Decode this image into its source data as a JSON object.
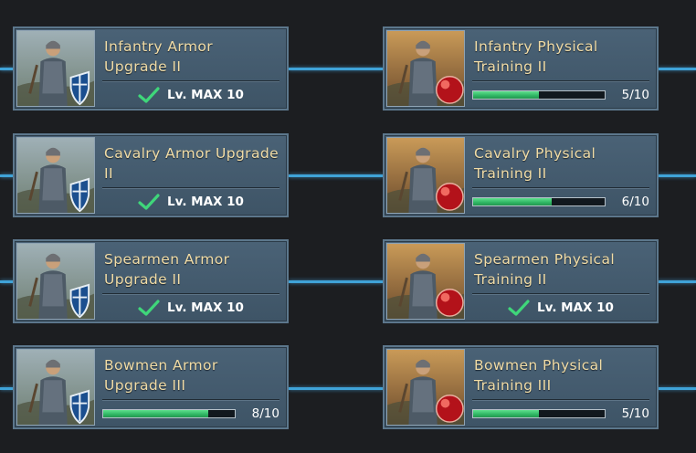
{
  "cards": [
    {
      "id": "infantry-armor",
      "title": "Infantry Armor\nUpgrade II",
      "type": "armor",
      "status": "max",
      "max_label": "Lv. MAX 10"
    },
    {
      "id": "infantry-physical",
      "title": "Infantry Physical\nTraining II",
      "type": "physical",
      "status": "progress",
      "progress_text": "5/10",
      "progress_fraction": 0.5
    },
    {
      "id": "cavalry-armor",
      "title": "Cavalry Armor Upgrade\n II",
      "type": "armor",
      "status": "max",
      "max_label": "Lv. MAX 10"
    },
    {
      "id": "cavalry-physical",
      "title": "Cavalry Physical\nTraining II",
      "type": "physical",
      "status": "progress",
      "progress_text": "6/10",
      "progress_fraction": 0.6
    },
    {
      "id": "spearmen-armor",
      "title": "Spearmen Armor\nUpgrade II",
      "type": "armor",
      "status": "max",
      "max_label": "Lv. MAX 10"
    },
    {
      "id": "spearmen-physical",
      "title": "Spearmen Physical\nTraining II",
      "type": "physical",
      "status": "max",
      "max_label": "Lv. MAX 10"
    },
    {
      "id": "bowmen-armor",
      "title": "Bowmen Armor\nUpgrade III",
      "type": "armor",
      "status": "progress",
      "progress_text": "8/10",
      "progress_fraction": 0.8
    },
    {
      "id": "bowmen-physical",
      "title": "Bowmen Physical\nTraining III",
      "type": "physical",
      "status": "progress",
      "progress_text": "5/10",
      "progress_fraction": 0.5
    }
  ],
  "colors": {
    "title_text": "#f1dca6",
    "connector": "#3fa3d8",
    "progress_fill": "#2fb563",
    "check": "#3fd67a"
  },
  "icons": {
    "max_status": "check-icon",
    "armor_badge": "shield-icon",
    "physical_badge": "red-orb-icon"
  }
}
